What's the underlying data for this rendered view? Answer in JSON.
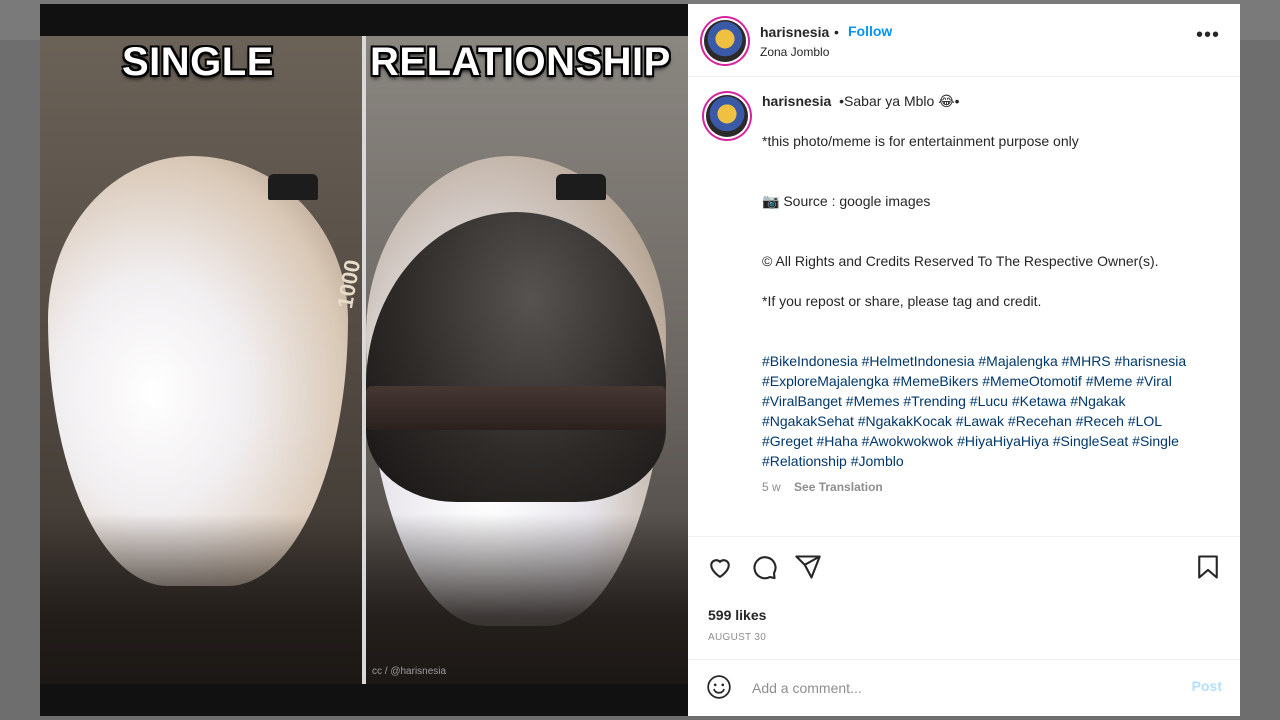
{
  "media": {
    "left_caption": "SINGLE",
    "right_caption": "RELATIONSHIP",
    "badge_text": "1000",
    "watermark": "cc / @harisnesia"
  },
  "header": {
    "username": "harisnesia",
    "separator": "•",
    "follow_label": "Follow",
    "location": "Zona Jomblo",
    "more_label": "•••"
  },
  "caption": {
    "username": "harisnesia",
    "title": "•Sabar ya Mblo 😂•",
    "lines": [
      "*this photo/meme is for entertainment purpose only",
      "📷 Source : google images",
      "© All Rights and Credits Reserved To The Respective Owner(s).",
      "*If you repost or share, please tag and credit."
    ],
    "hashtags": "#BikeIndonesia #HelmetIndonesia #Majalengka #MHRS #harisnesia #ExploreMajalengka #MemeBikers #MemeOtomotif #Meme #Viral #ViralBanget #Memes #Trending #Lucu #Ketawa #Ngakak #NgakakSehat #NgakakKocak #Lawak #Recehan #Receh #LOL #Greget #Haha #Awokwokwok #HiyaHiyaHiya #SingleSeat #Single #Relationship #Jomblo",
    "age": "5 w",
    "translate_label": "See Translation"
  },
  "actions": {
    "icons": [
      "heart-icon",
      "comment-icon",
      "share-icon",
      "bookmark-icon"
    ]
  },
  "likes": "599 likes",
  "date": "AUGUST 30",
  "comment": {
    "placeholder": "Add a comment...",
    "post_label": "Post"
  }
}
